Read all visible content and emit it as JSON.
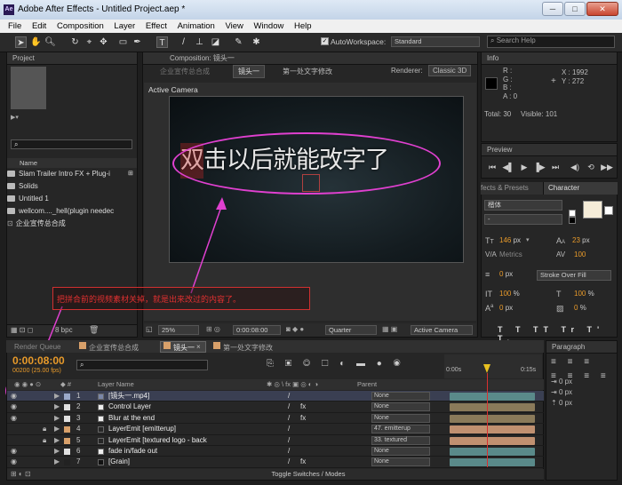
{
  "app": {
    "title": "Adobe After Effects - Untitled Project.aep *",
    "icon": "Ae",
    "win_buttons": [
      "─",
      "□",
      "✕"
    ]
  },
  "menu": [
    "File",
    "Edit",
    "Composition",
    "Layer",
    "Effect",
    "Animation",
    "View",
    "Window",
    "Help"
  ],
  "toolbar": {
    "auto_label": "AutoWorkspace:",
    "workspace": "Standard",
    "search_placeholder": "Search Help"
  },
  "project": {
    "tab": "Project",
    "col_name": "Name",
    "items": [
      {
        "label": "Slam Trailer Intro FX + Plug-i",
        "type": "folder"
      },
      {
        "label": "Solids",
        "type": "folder"
      },
      {
        "label": "Untitled 1",
        "type": "folder"
      },
      {
        "label": "wellcom...._hell(plugin needec",
        "type": "folder"
      },
      {
        "label": "企业宣传总合成",
        "type": "comp"
      }
    ],
    "bpc": "8 bpc"
  },
  "composition": {
    "tab": "Composition: 镜头一",
    "breadcrumbs": [
      "企业宣传总合成",
      "镜头一",
      "第一处文字修改"
    ],
    "renderer_label": "Renderer:",
    "renderer": "Classic 3D",
    "active_camera": "Active Camera",
    "big_text": "双击以后就能改字了",
    "annotation": "把拼合前的视频素材关掉，就是出来改过的内容了。",
    "zoom": "25%",
    "timecode": "0:00:08:00",
    "quality": "Quarter",
    "camera_drop": "Active Camera"
  },
  "info": {
    "tab": "Info",
    "rgba": [
      "R :",
      "G :",
      "B :",
      "A : 0"
    ],
    "x": "X : 1992",
    "y": "Y : 272",
    "total": "Total: 30",
    "visible": "Visible: 101"
  },
  "preview": {
    "tab": "Preview"
  },
  "character": {
    "tab_effects": "fects & Presets",
    "tab_char": "Character",
    "font": "楷体",
    "style": "-",
    "size": "146",
    "size_unit": "px",
    "leading": "23",
    "leading_unit": "px",
    "tracking": "Metrics",
    "tracking2": "100",
    "stroke": "0",
    "stroke_unit": "px",
    "stroke_mode": "Stroke Over Fill",
    "vscale": "100",
    "hscale": "100",
    "pct": "%",
    "baseline": "0",
    "baseline_unit": "px",
    "tsume": "0",
    "tsume_unit": "%"
  },
  "paragraph": {
    "tab": "Paragraph",
    "vals": [
      "0 px",
      "0 px",
      "0 px"
    ]
  },
  "timeline": {
    "tabs": [
      "Render Queue",
      "企业宣传总合成",
      "镜头一",
      "第一处文字修改"
    ],
    "timecode": "0:00:08:00",
    "fps": "00200 (25.00 fps)",
    "col_layer_name": "Layer Name",
    "col_parent": "Parent",
    "ruler": [
      "0:00s",
      "0:15s"
    ],
    "toggle": "Toggle Switches / Modes",
    "layers": [
      {
        "num": "1",
        "name": "[镜头一.mp4]",
        "color": "#9aa8c8",
        "parent": "None",
        "bar": "#5a8a8a",
        "fx": false
      },
      {
        "num": "2",
        "name": "Control Layer",
        "color": "#e0e0e0",
        "parent": "None",
        "bar": "#8a7a5a",
        "fx": true
      },
      {
        "num": "3",
        "name": "Blur at the end",
        "color": "#e0e0e0",
        "parent": "None",
        "bar": "#8a7a5a",
        "fx": true
      },
      {
        "num": "4",
        "name": "LayerEmit [emitterup]",
        "color": "#d8a06a",
        "parent": "47. emitterup",
        "bar": "#c09070",
        "fx": false
      },
      {
        "num": "5",
        "name": "LayerEmit [textured logo - back",
        "color": "#d8a06a",
        "parent": "33. textured",
        "bar": "#c09070",
        "fx": false
      },
      {
        "num": "6",
        "name": "fade in/fade out",
        "color": "#e0e0e0",
        "parent": "None",
        "bar": "#5a8a8a",
        "fx": false
      },
      {
        "num": "7",
        "name": "[Grain]",
        "color": "#222222",
        "parent": "None",
        "bar": "#5a8a8a",
        "fx": true
      }
    ]
  },
  "colors": {
    "accent_orange": "#e89a2a",
    "annotation_magenta": "#e040d0",
    "annotation_red": "#d03030"
  }
}
